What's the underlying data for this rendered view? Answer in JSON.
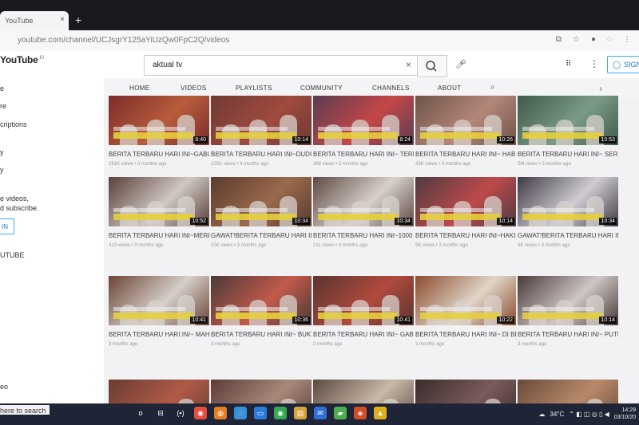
{
  "browser": {
    "tab_title": "YouTube",
    "tab_close": "×",
    "new_tab": "+",
    "url": "youtube.com/channel/UCJsgrY125aYiUzQw0FpC2Q/videos"
  },
  "youtube": {
    "logo": "YouTube",
    "logo_region": "ID",
    "search_value": "aktual tv",
    "clear": "×",
    "sign_in": "SIGN"
  },
  "nav": {
    "tabs": [
      "HOME",
      "VIDEOS",
      "PLAYLISTS",
      "COMMUNITY",
      "CHANNELS",
      "ABOUT"
    ],
    "active": "VIDEOS"
  },
  "sidebar": {
    "items": [
      "e",
      "re",
      "criptions",
      "y",
      "y",
      "e videos,",
      "d subscribe.",
      "IN",
      "UTUBE",
      "eo",
      "here to search"
    ]
  },
  "videos": [
    {
      "title": "BERITA TERBARU HARI INI~GABUNGAN POM TNI",
      "meta": "281K views • 3 months ago",
      "duration": "8:40",
      "colors": [
        "#7a2d2a",
        "#b85c3c"
      ]
    },
    {
      "title": "BERITA TERBARU HARI INI~DUDUNG...",
      "meta": "125K views • 4 months ago",
      "duration": "10:14",
      "colors": [
        "#6e3a34",
        "#a04a3e"
      ]
    },
    {
      "title": "BERITA TERBARU HARI INI~ TERBUKTI SUDAH KSAD",
      "meta": "368 views • 2 months ago",
      "duration": "8:24",
      "colors": [
        "#5a3d52",
        "#c44747"
      ]
    },
    {
      "title": "BERITA TERBARU HARI INI~ HABIB RIZIEQ BEBAS SI",
      "meta": "43K views • 3 months ago",
      "duration": "10:26",
      "colors": [
        "#6e5448",
        "#b4877a"
      ]
    },
    {
      "title": "BERITA TERBARU HARI INI~ SERENTAK TERKENA...",
      "meta": "5M views • 3 months ago",
      "duration": "10:53",
      "colors": [
        "#3f5b4b",
        "#7c9a88"
      ]
    },
    {
      "title": "BERITA TERBARU HARI INI~MERINDING WASIAT",
      "meta": "413 views • 3 months ago",
      "duration": "10:52",
      "colors": [
        "#5b3f3a",
        "#cfc8c2"
      ]
    },
    {
      "title": "GAWAT!BERITA TERBARU HARI INI~ PENGAKUAN 10",
      "meta": "10K views • 3 months ago",
      "duration": "10:34",
      "colors": [
        "#5a3b2e",
        "#9a6a4c"
      ]
    },
    {
      "title": "BERITA TERBARU HARI INI~1000 ULAMA TIDAK",
      "meta": "211 views • 3 months ago",
      "duration": "10:34",
      "colors": [
        "#5e4a44",
        "#d8d0ca"
      ]
    },
    {
      "title": "BERITA TERBARU HARI INI~HAKIM KHAWANTO",
      "meta": "9K views • 3 months ago",
      "duration": "10:14",
      "colors": [
        "#4f3b43",
        "#bd4a4a"
      ]
    },
    {
      "title": "GAWAT!BERITA TERBARU HARI INI~DOA UMAT",
      "meta": "5K views • 3 months ago",
      "duration": "10:34",
      "colors": [
        "#3f3a44",
        "#d0ccd2"
      ]
    },
    {
      "title": "BERITA TERBARU HARI INI~ MAHKAMAH",
      "meta": "3 months ago",
      "duration": "10:41",
      "colors": [
        "#6b4436",
        "#d6cfc9"
      ]
    },
    {
      "title": "BERITA TERBARU HARI INI~ BUKTIKAN",
      "meta": "3 months ago",
      "duration": "10:36",
      "colors": [
        "#4a3a38",
        "#c25a4a"
      ]
    },
    {
      "title": "BERITA TERBARU HARI INI~ GABUNGAN",
      "meta": "3 months ago",
      "duration": "10:41",
      "colors": [
        "#5a3530",
        "#b04a3c"
      ]
    },
    {
      "title": "BERITA TERBARU HARI INI~ DI BEBASKAN",
      "meta": "3 months ago",
      "duration": "10:22",
      "colors": [
        "#8a4a2c",
        "#e0d6c8"
      ]
    },
    {
      "title": "BERITA TERBARU HARI INI~ PUTRA",
      "meta": "3 months ago",
      "duration": "10:14",
      "colors": [
        "#4a3a3a",
        "#cfc6c6"
      ]
    },
    {
      "title": "",
      "meta": "",
      "duration": "",
      "colors": [
        "#6a3c32",
        "#b05a48"
      ]
    },
    {
      "title": "",
      "meta": "",
      "duration": "",
      "colors": [
        "#5a3c38",
        "#a8887a"
      ]
    },
    {
      "title": "",
      "meta": "",
      "duration": "",
      "colors": [
        "#5c4a40",
        "#c8b8a8"
      ]
    },
    {
      "title": "",
      "meta": "",
      "duration": "",
      "colors": [
        "#3a2c2c",
        "#7a5a5a"
      ]
    },
    {
      "title": "",
      "meta": "",
      "duration": "",
      "colors": [
        "#6a4a3a",
        "#b88a6a"
      ]
    }
  ],
  "taskbar": {
    "apps": [
      "o",
      "⊟",
      "(▪)",
      "◉",
      "◍",
      "◌",
      "▭",
      "◉",
      "▤",
      "✉",
      "▰",
      "◈",
      "▲"
    ],
    "temperature": "34°C",
    "time": "14:29",
    "date": "03/10/20"
  }
}
